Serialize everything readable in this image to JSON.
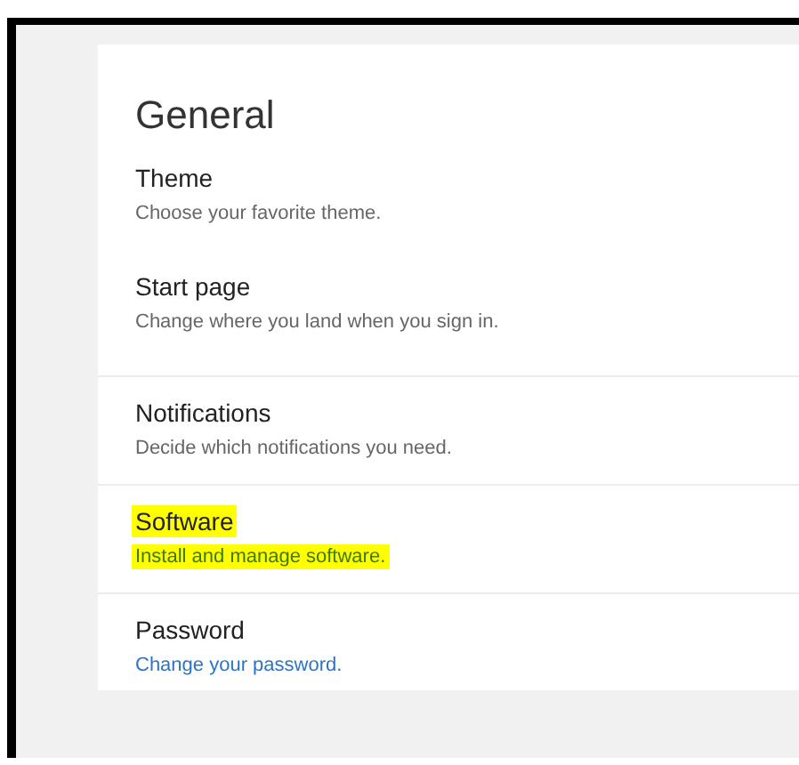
{
  "heading": "General",
  "items": [
    {
      "title": "Theme",
      "description": "Choose your favorite theme.",
      "separated": false,
      "highlighted": false,
      "link": false
    },
    {
      "title": "Start page",
      "description": "Change where you land when you sign in.",
      "separated": false,
      "highlighted": false,
      "link": false
    },
    {
      "title": "Notifications",
      "description": "Decide which notifications you need.",
      "separated": true,
      "highlighted": false,
      "link": false
    },
    {
      "title": "Software",
      "description": "Install and manage software.",
      "separated": true,
      "highlighted": true,
      "link": false
    },
    {
      "title": "Password",
      "description": "Change your password.",
      "separated": true,
      "highlighted": false,
      "link": true
    }
  ]
}
